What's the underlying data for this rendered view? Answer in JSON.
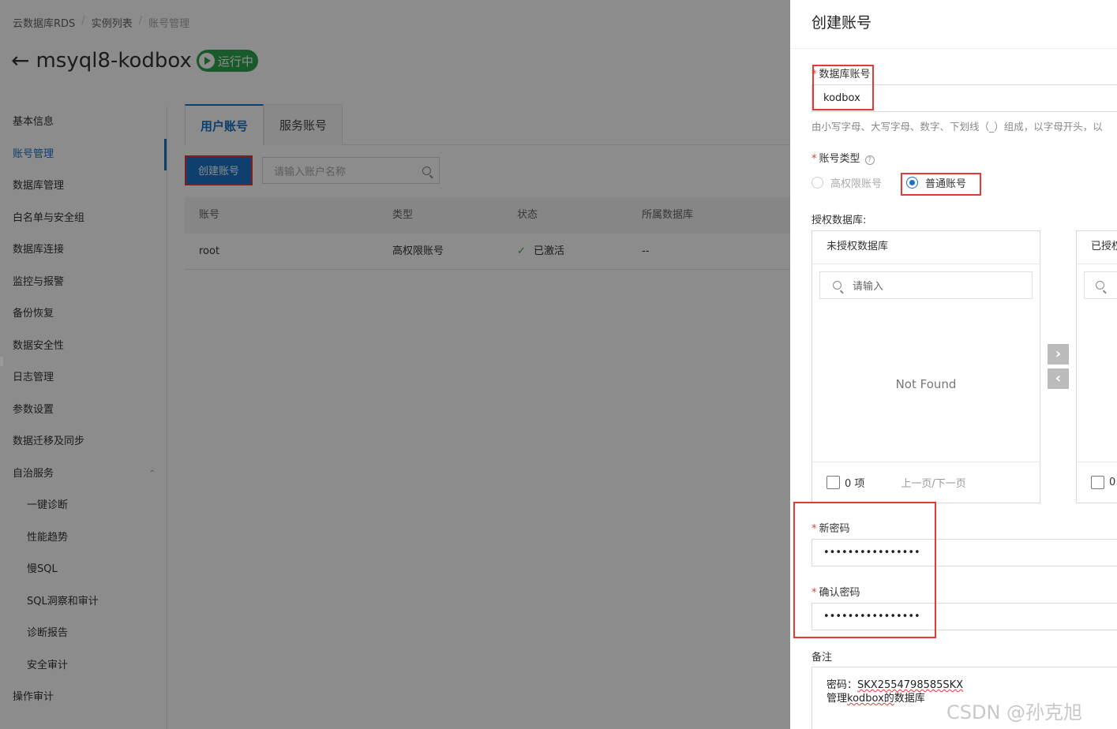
{
  "breadcrumb": [
    "云数据库RDS",
    "实例列表",
    "账号管理"
  ],
  "instance": {
    "name": "msyql8-kodbox",
    "status": "运行中"
  },
  "nav": {
    "items": [
      "基本信息",
      "账号管理",
      "数据库管理",
      "白名单与安全组",
      "数据库连接",
      "监控与报警",
      "备份恢复",
      "数据安全性",
      "日志管理",
      "参数设置",
      "数据迁移及同步",
      "自治服务"
    ],
    "sub_items": [
      "一键诊断",
      "性能趋势",
      "慢SQL",
      "SQL洞察和审计",
      "诊断报告",
      "安全审计"
    ],
    "last_item": "操作审计"
  },
  "tabs": [
    "用户账号",
    "服务账号"
  ],
  "toolbar": {
    "create_label": "创建账号",
    "search_placeholder": "请输入账户名称"
  },
  "table": {
    "headers": [
      "账号",
      "类型",
      "状态",
      "所属数据库"
    ],
    "rows": [
      {
        "account": "root",
        "type": "高权限账号",
        "status": "已激活",
        "db": "--"
      }
    ]
  },
  "drawer": {
    "title": "创建账号",
    "account_label": "数据库账号",
    "account_value": "kodbox",
    "account_hint": "由小写字母、大写字母、数字、下划线（_）组成，以字母开头，以",
    "type_label": "账号类型",
    "type_options": [
      "高权限账号",
      "普通账号"
    ],
    "type_selected": "普通账号",
    "db_label": "授权数据库:",
    "left_panel": {
      "title": "未授权数据库",
      "search_placeholder": "请输入",
      "empty": "Not Found",
      "count": "0 项",
      "pager": "上一页/下一页"
    },
    "right_panel": {
      "title": "已授权",
      "count": "0"
    },
    "new_password_label": "新密码",
    "new_password_value": "••••••••••••••••",
    "confirm_password_label": "确认密码",
    "confirm_password_value": "••••••••••••••••",
    "remark_label": "备注",
    "remark_line1_prefix": "密码：",
    "remark_line1_code": "SKX2554798585SKX",
    "remark_line2_prefix": "管理",
    "remark_line2_word": "kodbox的",
    "remark_line2_suffix": "数据库"
  },
  "watermark": "CSDN @孙克旭",
  "colors": {
    "accent": "#1a73c7",
    "running": "#2ea44f",
    "highlight": "#e53935"
  }
}
